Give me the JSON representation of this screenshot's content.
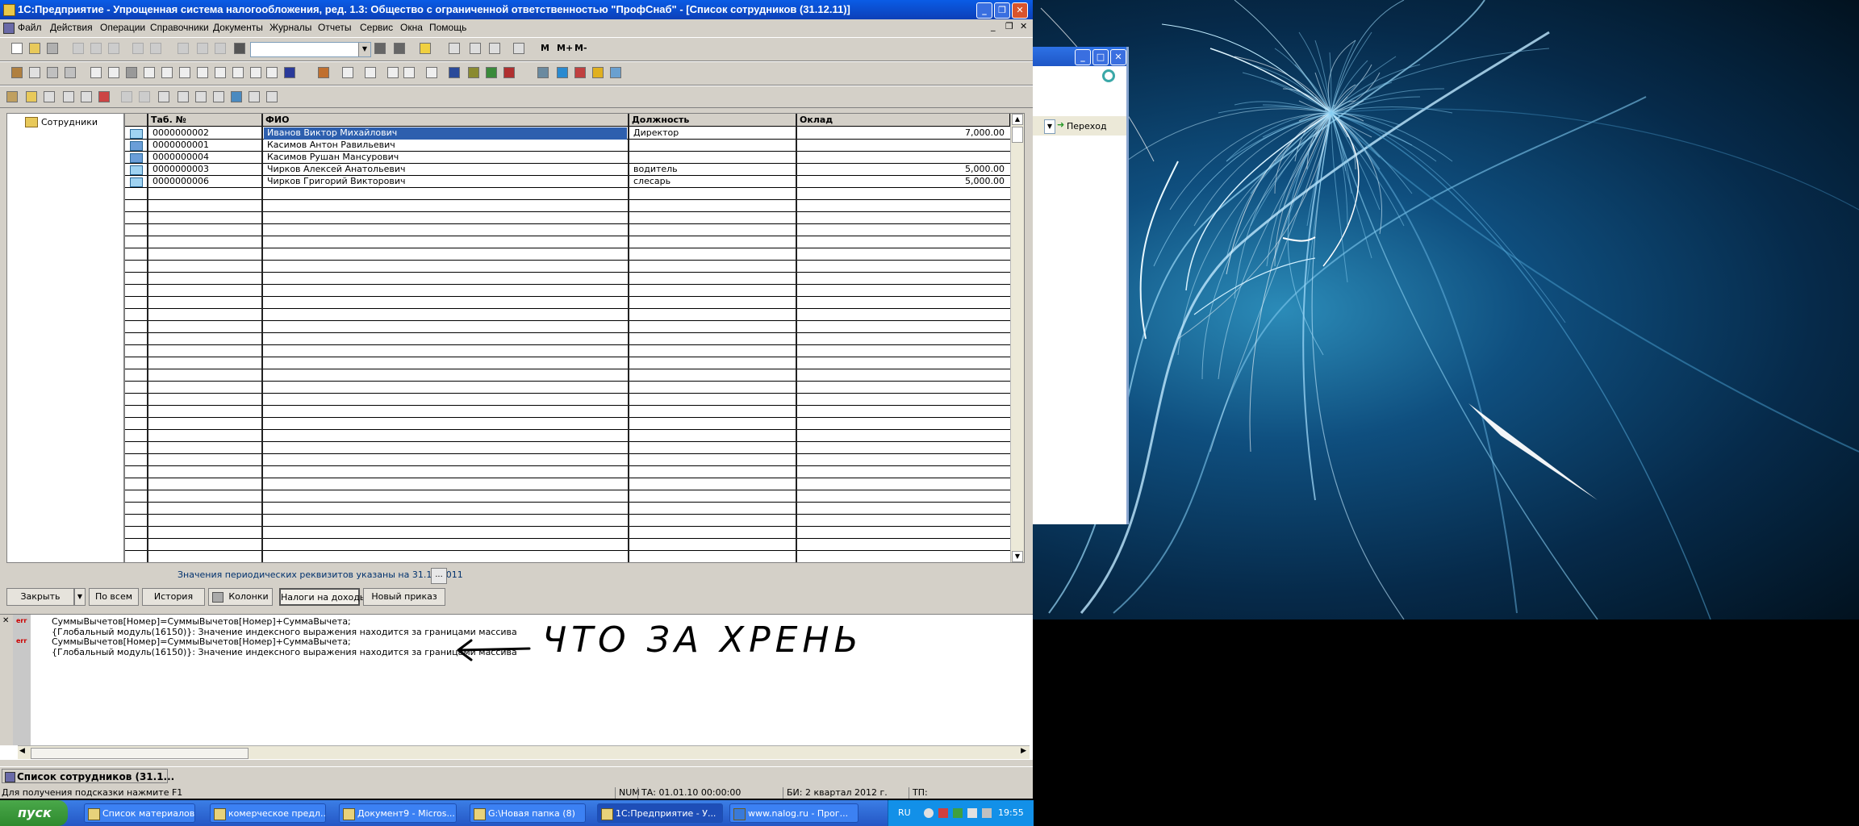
{
  "window": {
    "title": "1С:Предприятие - Упрощенная система налогообложения, ред. 1.3: Общество с ограниченной ответственностью \"ПрофСнаб\" - [Список сотрудников (31.12.11)]"
  },
  "menu": [
    "Файл",
    "Действия",
    "Операции",
    "Справочники",
    "Документы",
    "Журналы",
    "Отчеты",
    "Сервис",
    "Окна",
    "Помощь"
  ],
  "toolbar": {
    "m_buttons": [
      "M",
      "M+",
      "M-"
    ]
  },
  "tree": {
    "root": "Сотрудники"
  },
  "table": {
    "columns": [
      "Таб. №",
      "ФИО",
      "Должность",
      "Оклад"
    ],
    "rows": [
      {
        "tab": "0000000002",
        "fio": "Иванов Виктор Михайлович",
        "position": "Директор",
        "salary": "7,000.00",
        "icon": "employee-folder"
      },
      {
        "tab": "0000000001",
        "fio": "Касимов Антон Равильевич",
        "position": "",
        "salary": "",
        "icon": "employee-deleted"
      },
      {
        "tab": "0000000004",
        "fio": "Касимов Рушан Мансурович",
        "position": "",
        "salary": "",
        "icon": "employee-deleted"
      },
      {
        "tab": "0000000003",
        "fio": "Чирков Алексей Анатольевич",
        "position": "водитель",
        "salary": "5,000.00",
        "icon": "employee-folder"
      },
      {
        "tab": "0000000006",
        "fio": "Чирков Григорий Викторович",
        "position": "слесарь",
        "salary": "5,000.00",
        "icon": "employee-folder"
      }
    ]
  },
  "periodic_note": "Значения периодических реквизитов указаны на 31.12.2011",
  "periodic_button": "...",
  "buttons": {
    "close": "Закрыть",
    "all": "По всем",
    "history": "История",
    "columns": "Колонки",
    "taxes": "Налоги на доходы",
    "new_order": "Новый приказ"
  },
  "messages": [
    {
      "tag": "err",
      "text": "СуммыВычетов[Номер]=СуммыВычетов[Номер]+СуммаВычета;"
    },
    {
      "tag": "",
      "text": "{Глобальный модуль(16150)}: Значение индексного выражения находится за границами массива"
    },
    {
      "tag": "err",
      "text": "СуммыВычетов[Номер]=СуммыВычетов[Номер]+СуммаВычета;"
    },
    {
      "tag": "",
      "text": "{Глобальный модуль(16150)}: Значение индексного выражения находится за границами массива"
    }
  ],
  "annotation": "ЧТО ЗА ХРЕНЬ",
  "window_tab": "Список сотрудников (31.1...",
  "status": {
    "hint": "Для получения подсказки нажмите F1",
    "num": "NUM",
    "ta": "ТА: 01.01.10  00:00:00",
    "bi": "БИ: 2 квартал 2012 г.",
    "tp": "ТП:"
  },
  "background_window": {
    "go_label": "Переход"
  },
  "taskbar": {
    "start": "пуск",
    "tasks": [
      "Список материалов...",
      "комерческое предл...",
      "Документ9 - Micros...",
      "G:\\Новая папка (8)",
      "1С:Предприятие - У...",
      "www.nalog.ru - Прог..."
    ],
    "lang": "RU",
    "clock": "19:55"
  }
}
